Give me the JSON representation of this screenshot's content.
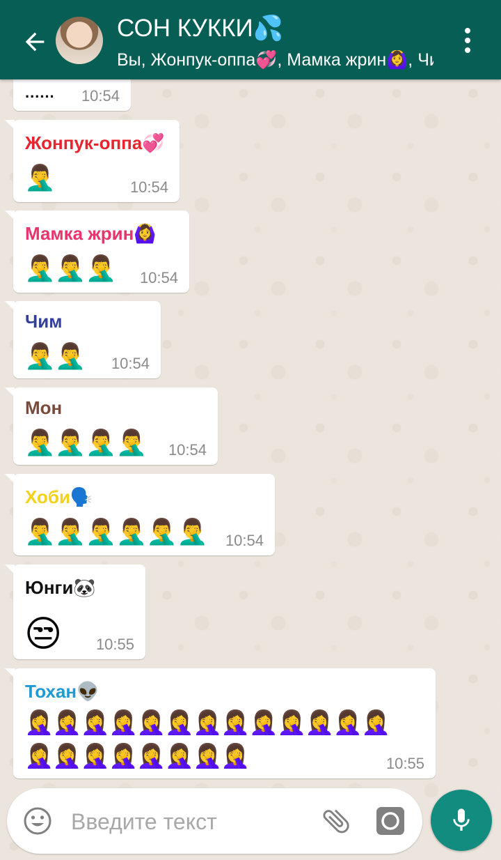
{
  "header": {
    "title": "СОН КУККИ💦",
    "subtitle": "Вы, Жонпук-оппа💞, Мамка жрин🙆‍♀️, Чим, Мон, Хоби🗣️, Юнги🐼, Тохан👽"
  },
  "colors": {
    "header_bg": "#075e54",
    "mic_bg": "#128c7e",
    "chat_bg": "#ece5dd"
  },
  "messages": [
    {
      "sender": "",
      "text": "......",
      "time": "10:54"
    },
    {
      "sender": "Жонпук-оппа💞",
      "sender_color": "#e8242e",
      "emojis": "🤦‍♂️",
      "time": "10:54"
    },
    {
      "sender": "Мамка жрин🙆‍♀️",
      "sender_color": "#e8356b",
      "emojis": "🤦‍♂️🤦‍♂️🤦‍♂️",
      "time": "10:54"
    },
    {
      "sender": "Чим",
      "sender_color": "#33409a",
      "emojis": "🤦‍♂️🤦‍♂️",
      "time": "10:54"
    },
    {
      "sender": "Мон",
      "sender_color": "#7a4b3a",
      "emojis": "🤦‍♂️🤦‍♂️🤦‍♂️🤦‍♂️",
      "time": "10:54"
    },
    {
      "sender": "Хоби🗣️",
      "sender_color": "#f2d21b",
      "emojis": "🤦‍♂️🤦‍♂️🤦‍♂️🤦‍♂️🤦‍♂️🤦‍♂️",
      "time": "10:54"
    },
    {
      "sender": "Юнги🐼",
      "sender_color": "#111111",
      "emojis": "😒",
      "time": "10:55"
    },
    {
      "sender": "Тохан👽",
      "sender_color": "#1e9ad6",
      "emojis_line1": "🤦‍♀️🤦‍♀️🤦‍♀️🤦‍♀️🤦‍♀️🤦‍♀️🤦‍♀️🤦‍♀️🤦‍♀️🤦‍♀️🤦‍♀️🤦‍♀️🤦‍♀️",
      "emojis_line2": "🤦‍♀️🤦‍♀️🤦‍♀️🤦‍♀️🤦‍♀️🤦‍♀️🤦‍♀️🤦‍♀️",
      "time": "10:55"
    }
  ],
  "input": {
    "placeholder": "Введите текст"
  },
  "icons": {
    "back": "arrow-left-icon",
    "menu": "more-vert-icon",
    "emoji": "smiley-icon",
    "attach": "paperclip-icon",
    "camera": "camera-icon",
    "mic": "microphone-icon"
  }
}
